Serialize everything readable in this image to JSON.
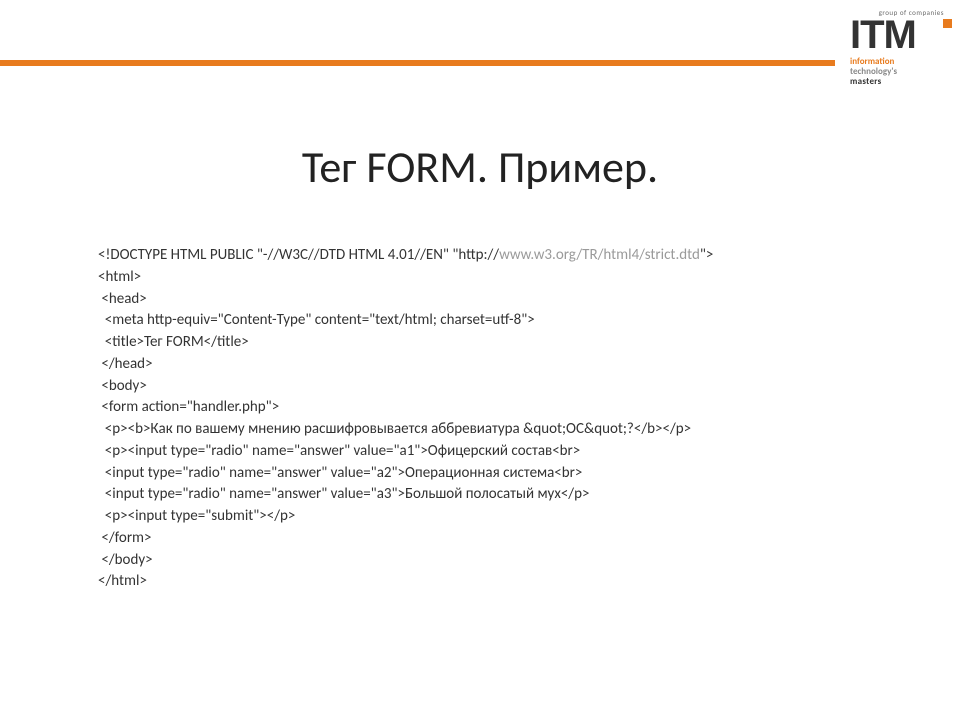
{
  "logo": {
    "group": "group of companies",
    "brand": "ITM",
    "sub1": "information",
    "sub2": "technology's",
    "sub3": "masters"
  },
  "title": "Тег FORM. Пример.",
  "code": {
    "l01a": "<!DOCTYPE HTML PUBLIC \"-//W3C//DTD HTML 4.01//EN\" \"http://",
    "l01b": "www.w3.org/TR/html4/strict.dtd",
    "l01c": "\">",
    "l02": "<html>",
    "l03": " <head>",
    "l04": "  <meta http-equiv=\"Content-Type\" content=\"text/html; charset=utf-8\">",
    "l05": "  <title>Тег FORM</title>",
    "l06": " </head>",
    "l07": " <body>",
    "l08": " <form action=\"handler.php\">",
    "l09": "  <p><b>Как по вашему мнению расшифровывается аббревиатура &quot;ОС&quot;?</b></p>",
    "l10": "  <p><input type=\"radio\" name=\"answer\" value=\"a1\">Офицерский состав<br>",
    "l11": "  <input type=\"radio\" name=\"answer\" value=\"a2\">Операционная система<br>",
    "l12": "  <input type=\"radio\" name=\"answer\" value=\"a3\">Большой полосатый мух</p>",
    "l13": "  <p><input type=\"submit\"></p>",
    "l14": " </form>",
    "l15": " </body>",
    "l16": "</html>"
  }
}
